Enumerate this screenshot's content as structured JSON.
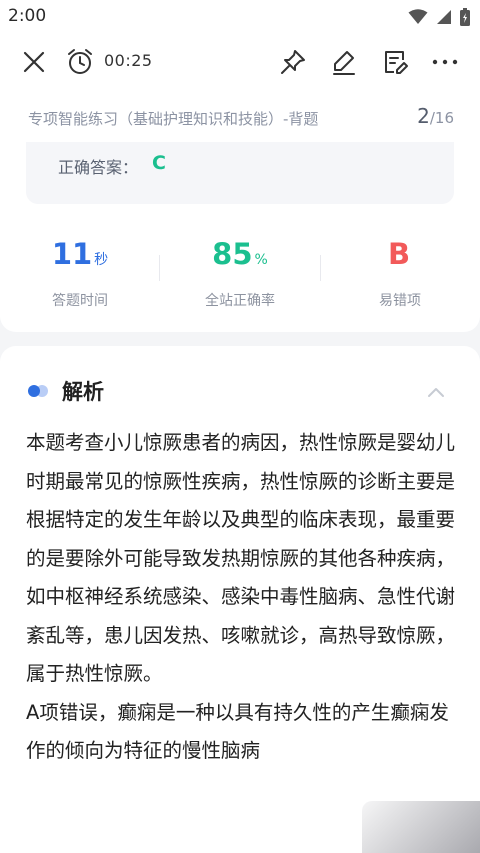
{
  "status_bar": {
    "time": "2:00"
  },
  "toolbar": {
    "timer": "00:25"
  },
  "header": {
    "subtitle": "专项智能练习（基础护理知识和技能）-背题",
    "current": "2",
    "total": "/16"
  },
  "answer": {
    "label": "正确答案：",
    "value": "C"
  },
  "stats": [
    {
      "value": "11",
      "unit": "秒",
      "label": "答题时间",
      "color": "#2f6fe0"
    },
    {
      "value": "85",
      "unit": "%",
      "label": "全站正确率",
      "color": "#1bbf8f"
    },
    {
      "value": "B",
      "unit": "",
      "label": "易错项",
      "color": "#f25a5a"
    }
  ],
  "analysis": {
    "title": "解析",
    "paragraphs": [
      "本题考查小儿惊厥患者的病因，热性惊厥是婴幼儿时期最常见的惊厥性疾病，热性惊厥的诊断主要是根据特定的发生年龄以及典型的临床表现，最重要的是要除外可能导致发热期惊厥的其他各种疾病，如中枢神经系统感染、感染中毒性脑病、急性代谢紊乱等，患儿因发热、咳嗽就诊，高热导致惊厥，属于热性惊厥。",
      "A项错误，癫痫是一种以具有持久性的产生癫痫发作的倾向为特征的慢性脑病"
    ]
  },
  "colors": {
    "accent_blue": "#2f6fe0",
    "accent_green": "#1bbf8f",
    "accent_red": "#f25a5a"
  }
}
